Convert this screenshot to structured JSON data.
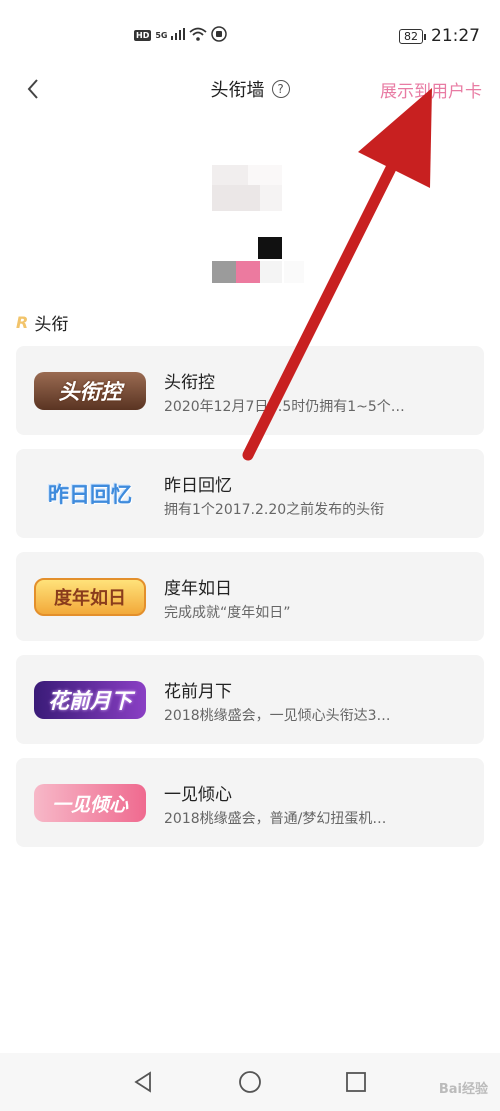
{
  "status_bar": {
    "hd": "HD",
    "network": "5G",
    "battery": "82",
    "time": "21:27"
  },
  "header": {
    "title": "头衔墙",
    "help_symbol": "?",
    "action_label": "展示到用户卡"
  },
  "section": {
    "icon": "R",
    "title": "头衔"
  },
  "titles": [
    {
      "badge_text": "头衔控",
      "name": "头衔控",
      "desc": "2020年12月7日…5时仍拥有1~5个…"
    },
    {
      "badge_text": "昨日回忆",
      "name": "昨日回忆",
      "desc": "拥有1个2017.2.20之前发布的头衔"
    },
    {
      "badge_text": "度年如日",
      "name": "度年如日",
      "desc": "完成成就“度年如日”"
    },
    {
      "badge_text": "花前月下",
      "name": "花前月下",
      "desc": "2018桃缘盛会，一见倾心头衔达3…"
    },
    {
      "badge_text": "一见倾心",
      "name": "一见倾心",
      "desc": "2018桃缘盛会，普通/梦幻扭蛋机…"
    }
  ],
  "watermark": "Bai经验",
  "colors": {
    "accent_pink": "#e87ba3",
    "card_bg": "#f4f4f4",
    "arrow_red": "#c82020"
  },
  "icons": [
    "hd-icon",
    "signal-icon",
    "wifi-icon",
    "battery-icon",
    "back-icon",
    "help-icon",
    "r-icon",
    "triangle-back-icon",
    "circle-home-icon",
    "square-recents-icon"
  ]
}
